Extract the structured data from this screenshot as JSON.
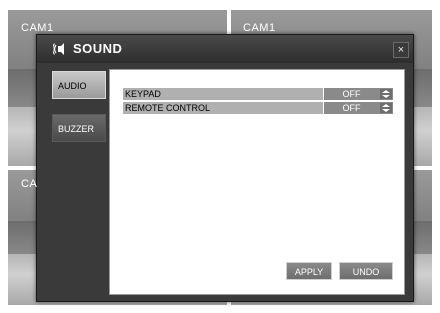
{
  "cameras": [
    {
      "label": "CAM1"
    },
    {
      "label": "CAM1"
    },
    {
      "label": "CA"
    },
    {
      "label": ""
    }
  ],
  "dialog": {
    "title": "SOUND",
    "title_icon": "speaker-icon",
    "close_label": "×"
  },
  "tabs": [
    {
      "label": "AUDIO",
      "selected": true
    },
    {
      "label": "BUZZER",
      "selected": false
    }
  ],
  "settings": [
    {
      "label": "KEYPAD",
      "value": "OFF"
    },
    {
      "label": "REMOTE CONTROL",
      "value": "OFF"
    }
  ],
  "buttons": {
    "apply": "APPLY",
    "undo": "UNDO"
  },
  "colors": {
    "dialog_bg": "#3a3a3a",
    "panel_bg": "#ffffff",
    "row_label_bg": "#b0b0b0",
    "row_value_bg": "#8a8a8a"
  }
}
